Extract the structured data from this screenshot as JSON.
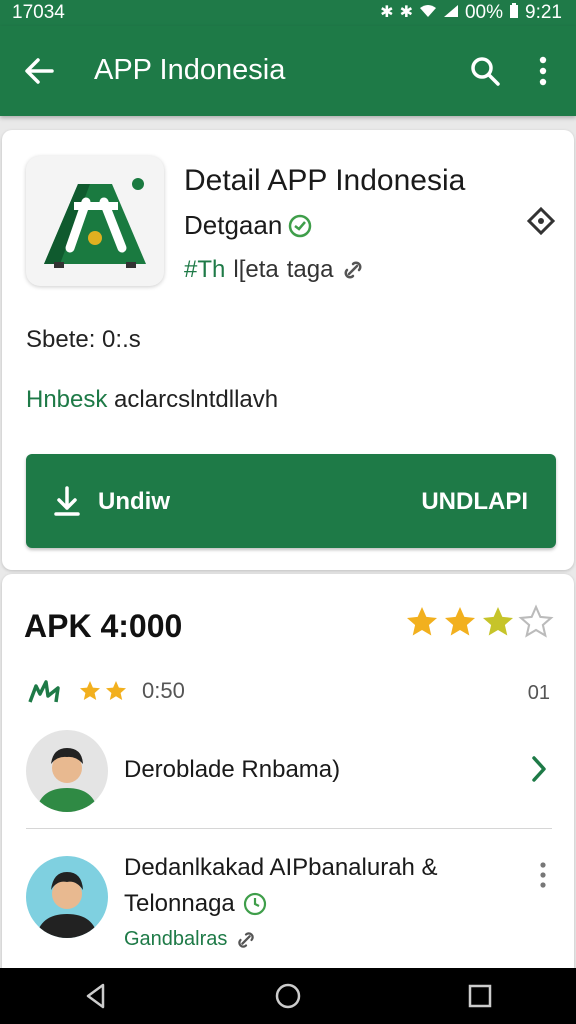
{
  "status_bar": {
    "time_left": "17034",
    "battery": "00%",
    "clock": "9:21"
  },
  "app_bar": {
    "title": "APP Indonesia"
  },
  "app_card": {
    "name": "Detail APP Indonesia",
    "developer": "Detgaan",
    "tag_hash": "#Th",
    "tag_text": "l[eta",
    "tag_suffix": "taga",
    "size_label": "Sbete: 0:.s",
    "desc_accent": "Hnbesk",
    "desc_rest": " aclarcslntdllavh",
    "install_left": "Undiw",
    "install_right": "UNDLAPI"
  },
  "rating_card": {
    "title": "APK 4:000",
    "stars": 3,
    "rating_sub": "0:50",
    "rating_right": "01",
    "thumb_label": "ılʒ",
    "reviews": [
      {
        "name": "Deroblade Rnbama)"
      },
      {
        "line1": "Dedanlkakad AIPbanalurah &",
        "line2": "Telonnaga",
        "line3": "Gandbalras"
      }
    ]
  },
  "colors": {
    "brand_green": "#1e7a47",
    "star_gold": "#f2b01e"
  }
}
